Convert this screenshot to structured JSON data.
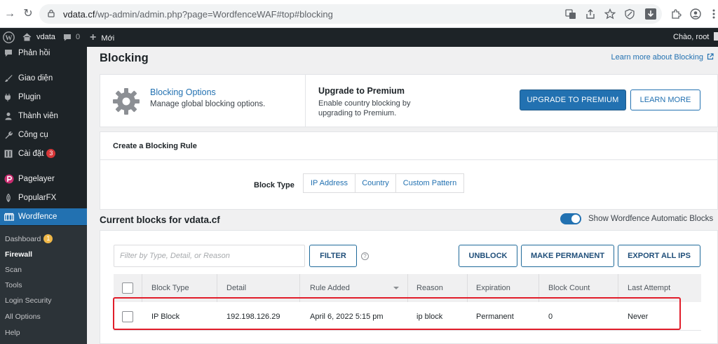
{
  "browser": {
    "url_host": "vdata.cf",
    "url_path": "/wp-admin/admin.php?page=WordfenceWAF#top#blocking"
  },
  "admin_bar": {
    "site_name": "vdata",
    "comments_count": "0",
    "new_label": "Mới",
    "greeting": "Chào, root"
  },
  "sidebar": {
    "items": [
      {
        "label": "Phản hồi",
        "icon": "comment-icon"
      },
      {
        "label": "Giao diện",
        "icon": "brush-icon"
      },
      {
        "label": "Plugin",
        "icon": "plugin-icon"
      },
      {
        "label": "Thành viên",
        "icon": "user-icon"
      },
      {
        "label": "Công cụ",
        "icon": "wrench-icon"
      },
      {
        "label": "Cài đặt",
        "icon": "settings-icon",
        "badge": "3"
      },
      {
        "label": "Pagelayer",
        "icon": "pagelayer-icon"
      },
      {
        "label": "PopularFX",
        "icon": "popularfx-icon"
      },
      {
        "label": "Wordfence",
        "icon": "wordfence-icon"
      }
    ],
    "submenu": [
      {
        "label": "Dashboard",
        "badge": "1"
      },
      {
        "label": "Firewall"
      },
      {
        "label": "Scan"
      },
      {
        "label": "Tools"
      },
      {
        "label": "Login Security"
      },
      {
        "label": "All Options"
      },
      {
        "label": "Help"
      }
    ]
  },
  "page": {
    "title": "Blocking",
    "learn_more": "Learn more about Blocking"
  },
  "options_card": {
    "title": "Blocking Options",
    "description": "Manage global blocking options.",
    "upgrade_title": "Upgrade to Premium",
    "upgrade_desc": "Enable country blocking by upgrading to Premium.",
    "upgrade_button": "UPGRADE TO PREMIUM",
    "learn_more_button": "LEARN MORE"
  },
  "rule_card": {
    "heading": "Create a Blocking Rule",
    "block_type_label": "Block Type",
    "block_types": [
      "IP Address",
      "Country",
      "Custom Pattern"
    ]
  },
  "current_blocks": {
    "title": "Current blocks for vdata.cf",
    "toggle_label": "Show Wordfence Automatic Blocks",
    "toggle_on": true,
    "filter_placeholder": "Filter by Type, Detail, or Reason",
    "filter_button": "FILTER",
    "unblock_button": "UNBLOCK",
    "permanent_button": "MAKE PERMANENT",
    "export_button": "EXPORT ALL IPS",
    "columns": [
      "Block Type",
      "Detail",
      "Rule Added",
      "Reason",
      "Expiration",
      "Block Count",
      "Last Attempt"
    ],
    "rows": [
      {
        "block_type": "IP Block",
        "detail": "192.198.126.29",
        "rule_added": "April 6, 2022 5:15 pm",
        "reason": "ip block",
        "expiration": "Permanent",
        "block_count": "0",
        "last_attempt": "Never"
      }
    ]
  },
  "colors": {
    "accent": "#2271b1",
    "admin_dark": "#1d2327",
    "highlight": "#e11d2a"
  }
}
